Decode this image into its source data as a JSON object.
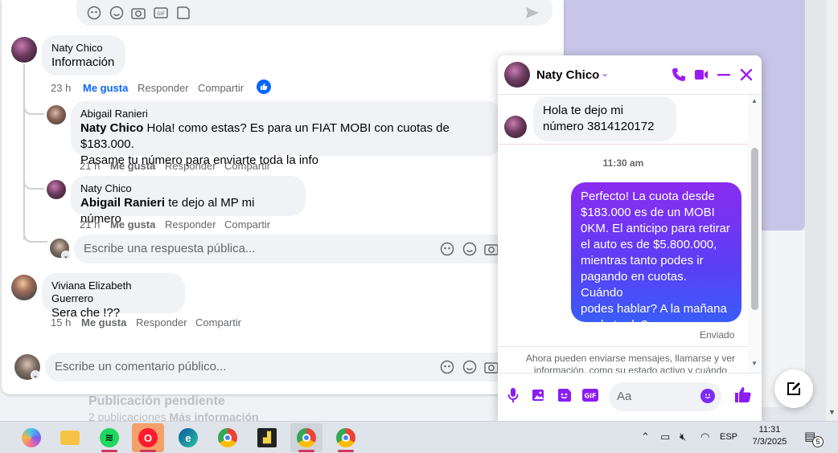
{
  "background": {
    "pending_title": "Publicación pendiente",
    "pending_count": "2 publicaciones",
    "pending_more": "Más información"
  },
  "comments": [
    {
      "author": "Naty Chico",
      "text": "Información",
      "time": "23 h",
      "like": "Me gusta",
      "reply": "Responder",
      "share": "Compartir",
      "liked": true
    },
    {
      "author": "Abigail Ranieri",
      "mention": "Naty Chico",
      "text_line1": " Hola! como estas? Es para un FIAT MOBI con cuotas de $183.000.",
      "text_line2": "Pasame tu número para enviarte toda la info",
      "time": "21 h",
      "like": "Me gusta",
      "reply": "Responder",
      "share": "Compartir"
    },
    {
      "author": "Naty Chico",
      "mention": "Abigail Ranieri",
      "text": " te dejo al MP mi número",
      "time": "21 h",
      "like": "Me gusta",
      "reply": "Responder",
      "share": "Compartir"
    },
    {
      "author": "Viviana Elizabeth Guerrero",
      "text": "Sera che !??",
      "time": "15 h",
      "like": "Me gusta",
      "reply": "Responder",
      "share": "Compartir"
    }
  ],
  "reply_input": {
    "placeholder": "Escribe una respuesta pública..."
  },
  "comment_input": {
    "placeholder": "Escribe un comentario público..."
  },
  "chat": {
    "contact_name": "Naty Chico",
    "incoming_line1": "Hola te dejo mi",
    "incoming_line2": "número 3814120172",
    "time_separator": "11:30 am",
    "outgoing_lines": [
      "Perfecto! La cuota desde",
      "$183.000 es de un MOBI",
      "0KM. El anticipo para retirar",
      "el auto es de $5.800.000,",
      "mientras tanto podes ir",
      "pagando en cuotas. Cuándo",
      "podes hablar? A la mañana",
      "o a la tarde?"
    ],
    "status": "Enviado",
    "notice_line1": "Ahora pueden enviarse mensajes, llamarse y ver",
    "notice_line2": "información, como su estado activo y cuándo",
    "input_placeholder": "Aa"
  },
  "taskbar": {
    "language": "ESP",
    "time": "11:31",
    "date": "7/3/2025",
    "notification_count": "5"
  },
  "colors": {
    "messenger_accent": "#8a1cf5",
    "facebook_blue": "#0866ff"
  }
}
